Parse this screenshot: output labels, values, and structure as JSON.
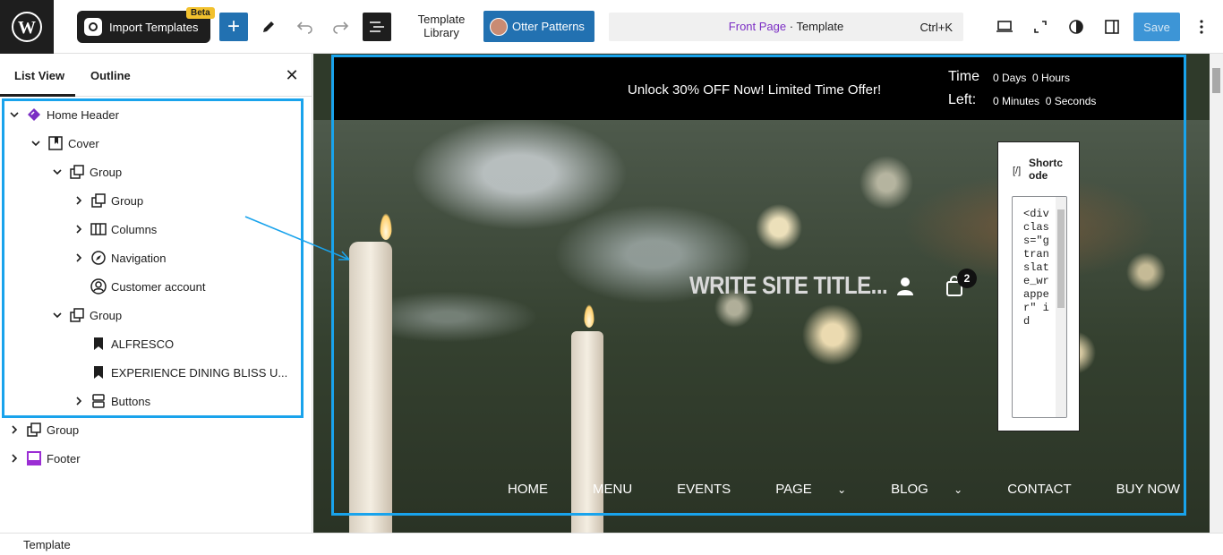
{
  "topbar": {
    "import_label": "Import Templates",
    "beta_label": "Beta",
    "template_library_line1": "Template",
    "template_library_line2": "Library",
    "otter_label": "Otter Patterns",
    "command_front": "Front Page",
    "command_sep": " · ",
    "command_type": "Template",
    "command_shortcut": "Ctrl+K",
    "save_label": "Save"
  },
  "sidebar": {
    "tab_list_view": "List View",
    "tab_outline": "Outline",
    "tree": [
      {
        "label": "Home Header",
        "icon": "template-part-icon",
        "expanded": true
      },
      {
        "label": "Cover",
        "icon": "cover-icon",
        "expanded": true
      },
      {
        "label": "Group",
        "icon": "group-icon",
        "expanded": true
      },
      {
        "label": "Group",
        "icon": "group-icon",
        "expanded": false
      },
      {
        "label": "Columns",
        "icon": "columns-icon",
        "expanded": false
      },
      {
        "label": "Navigation",
        "icon": "navigation-icon",
        "expanded": false
      },
      {
        "label": "Customer account",
        "icon": "customer-account-icon"
      },
      {
        "label": "Group",
        "icon": "group-icon",
        "expanded": true
      },
      {
        "label": "ALFRESCO",
        "icon": "bookmark-icon"
      },
      {
        "label": "EXPERIENCE DINING BLISS U...",
        "icon": "bookmark-icon"
      },
      {
        "label": "Buttons",
        "icon": "buttons-icon",
        "expanded": false
      },
      {
        "label": "Group",
        "icon": "group-icon",
        "expanded": false
      },
      {
        "label": "Footer",
        "icon": "footer-icon",
        "expanded": false
      }
    ]
  },
  "status_bar": {
    "label": "Template"
  },
  "canvas": {
    "promo_text": "Unlock 30% OFF Now! Limited Time Offer!",
    "timer_time": "Time",
    "timer_left": "Left:",
    "timer_days": "0 Days",
    "timer_hours": "0 Hours",
    "timer_minutes": "0 Minutes",
    "timer_seconds": "0 Seconds",
    "site_title": "WRITE SITE TITLE...",
    "cart_count": "2",
    "shortcode_title": "Shortcode",
    "shortcode_icon": "[/]",
    "shortcode_text": "<div class=\"gtranslate_wrapper\" id",
    "menu": [
      "HOME",
      "MENU",
      "EVENTS",
      "PAGE",
      "BLOG",
      "CONTACT",
      "BUY NOW"
    ]
  },
  "colors": {
    "accent": "#2271b1",
    "highlight": "#19a3ec",
    "template_part": "#7b2ec4"
  }
}
